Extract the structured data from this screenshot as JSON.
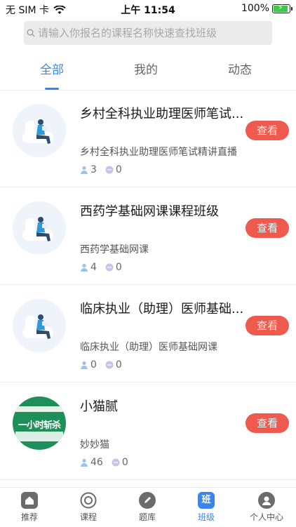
{
  "status_bar": {
    "carrier": "无 SIM 卡",
    "time": "上午 11:54",
    "battery_percent": "100%",
    "battery_level": 1.0
  },
  "search": {
    "placeholder": "请输入你报名的课程名称快速查找班级"
  },
  "tabs": [
    {
      "label": "全部",
      "active": true
    },
    {
      "label": "我的",
      "active": false
    },
    {
      "label": "动态",
      "active": false
    }
  ],
  "classes": [
    {
      "title": "乡村全科执业助理医师笔试...",
      "subtitle": "乡村全科执业助理医师笔试精讲直播",
      "members": "3",
      "messages": "0",
      "button": "查看"
    },
    {
      "title": "西药学基础网课课程班级",
      "subtitle": "西药学基础网课",
      "members": "4",
      "messages": "0",
      "button": "查看"
    },
    {
      "title": "临床执业（助理）医师基础...",
      "subtitle": "临床执业（助理）医师基础网课",
      "members": "0",
      "messages": "0",
      "button": "查看"
    },
    {
      "title": "小猫腻",
      "subtitle": "妙妙猫",
      "members": "46",
      "messages": "0",
      "button": "查看"
    }
  ],
  "class4_thumb_text": "一小时斩杀",
  "bottom_nav": [
    {
      "label": "推荐",
      "icon": "home-icon"
    },
    {
      "label": "课程",
      "icon": "course-icon"
    },
    {
      "label": "题库",
      "icon": "pen-icon"
    },
    {
      "label": "班级",
      "icon": "class-icon",
      "glyph": "班",
      "active": true
    },
    {
      "label": "个人中心",
      "icon": "person-icon"
    }
  ],
  "colors": {
    "accent": "#3a86e8",
    "button": "#ef5a4e",
    "battery": "#3cc84a"
  }
}
